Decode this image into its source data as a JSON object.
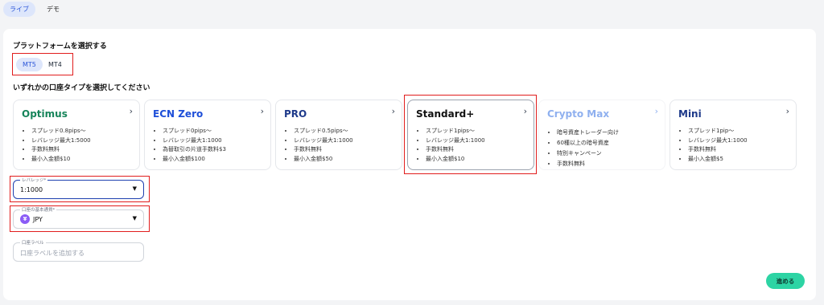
{
  "top_tabs": [
    {
      "label": "ライブ",
      "active": true
    },
    {
      "label": "デモ",
      "active": false
    }
  ],
  "platform_title": "プラットフォームを選択する",
  "platforms": [
    {
      "label": "MT5",
      "active": true
    },
    {
      "label": "MT4",
      "active": false
    }
  ],
  "account_type_title": "いずれかの口座タイプを選択してください",
  "cards": [
    {
      "name": "Optimus",
      "color": "#16845a",
      "features": [
        "スプレッド0.8pips〜",
        "レバレッジ最大1:5000",
        "手数料無料",
        "最小入金額$10"
      ]
    },
    {
      "name": "ECN Zero",
      "color": "#1d4ed8",
      "features": [
        "スプレッド0pips〜",
        "レバレッジ最大1:1000",
        "為替取引の片道手数料$3",
        "最小入金額$100"
      ]
    },
    {
      "name": "PRO",
      "color": "#1e3a8a",
      "features": [
        "スプレッド0.5pips〜",
        "レバレッジ最大1:1000",
        "手数料無料",
        "最小入金額$50"
      ]
    },
    {
      "name": "Standard+",
      "color": "#111111",
      "features": [
        "スプレッド1pips〜",
        "レバレッジ最大1:1000",
        "手数料無料",
        "最小入金額$10"
      ]
    },
    {
      "name": "Crypto Max",
      "color": "#8fb0ef",
      "features": [
        "暗号資産トレーダー向け",
        "60種以上の暗号資産",
        "特別キャンペーン",
        "手数料無料"
      ]
    },
    {
      "name": "Mini",
      "color": "#1e3a8a",
      "features": [
        "スプレッド1pip〜",
        "レバレッジ最大1:1000",
        "手数料無料",
        "最小入金額$5"
      ]
    }
  ],
  "leverage": {
    "label": "レバレッジ*",
    "value": "1:1000"
  },
  "currency": {
    "label": "口座の基本通貨*",
    "value": "JPY",
    "symbol": "¥"
  },
  "account_label": {
    "label": "口座ラベル",
    "placeholder": "口座ラベルを追加する"
  },
  "next_button": "進める",
  "colors": {
    "accent": "#2dd4a4",
    "highlight": "#e11d1d",
    "tab_active_bg": "#dde6fb"
  }
}
